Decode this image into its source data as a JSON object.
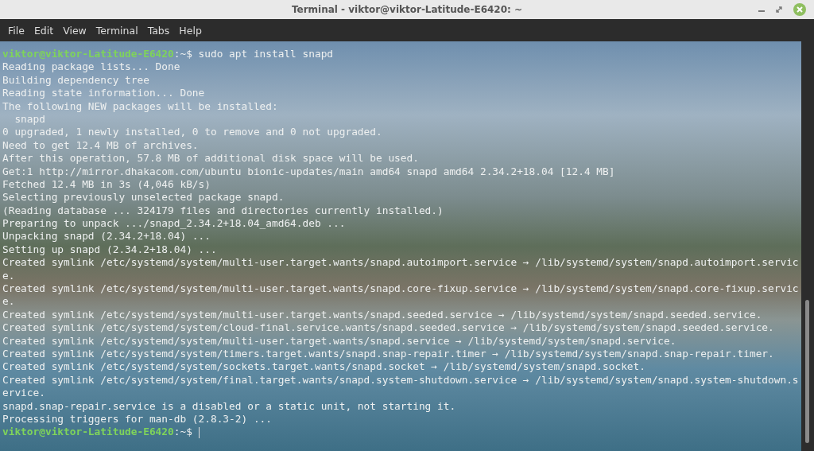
{
  "window": {
    "title": "Terminal - viktor@viktor-Latitude-E6420: ~"
  },
  "menu": [
    "File",
    "Edit",
    "View",
    "Terminal",
    "Tabs",
    "Help"
  ],
  "terminal": {
    "lines": [
      {
        "kind": "prompt",
        "host": "viktor@viktor-Latitude-E6420",
        "prompt": ":~$ ",
        "command": "sudo apt install snapd"
      },
      {
        "kind": "output",
        "text": "Reading package lists... Done"
      },
      {
        "kind": "output",
        "text": "Building dependency tree"
      },
      {
        "kind": "output",
        "text": "Reading state information... Done"
      },
      {
        "kind": "output",
        "text": "The following NEW packages will be installed:"
      },
      {
        "kind": "output",
        "text": "  snapd"
      },
      {
        "kind": "output",
        "text": "0 upgraded, 1 newly installed, 0 to remove and 0 not upgraded."
      },
      {
        "kind": "output",
        "text": "Need to get 12.4 MB of archives."
      },
      {
        "kind": "output",
        "text": "After this operation, 57.8 MB of additional disk space will be used."
      },
      {
        "kind": "output",
        "text": "Get:1 http://mirror.dhakacom.com/ubuntu bionic-updates/main amd64 snapd amd64 2.34.2+18.04 [12.4 MB]"
      },
      {
        "kind": "output",
        "text": "Fetched 12.4 MB in 3s (4,046 kB/s)"
      },
      {
        "kind": "output",
        "text": "Selecting previously unselected package snapd."
      },
      {
        "kind": "output",
        "text": "(Reading database ... 324179 files and directories currently installed.)"
      },
      {
        "kind": "output",
        "text": "Preparing to unpack .../snapd_2.34.2+18.04_amd64.deb ..."
      },
      {
        "kind": "output",
        "text": "Unpacking snapd (2.34.2+18.04) ..."
      },
      {
        "kind": "output",
        "text": "Setting up snapd (2.34.2+18.04) ..."
      },
      {
        "kind": "output",
        "text": "Created symlink /etc/systemd/system/multi-user.target.wants/snapd.autoimport.service → /lib/systemd/system/snapd.autoimport.servic"
      },
      {
        "kind": "output",
        "text": "e."
      },
      {
        "kind": "output",
        "text": "Created symlink /etc/systemd/system/multi-user.target.wants/snapd.core-fixup.service → /lib/systemd/system/snapd.core-fixup.servic"
      },
      {
        "kind": "output",
        "text": "e."
      },
      {
        "kind": "output",
        "text": "Created symlink /etc/systemd/system/multi-user.target.wants/snapd.seeded.service → /lib/systemd/system/snapd.seeded.service."
      },
      {
        "kind": "output",
        "text": "Created symlink /etc/systemd/system/cloud-final.service.wants/snapd.seeded.service → /lib/systemd/system/snapd.seeded.service."
      },
      {
        "kind": "output",
        "text": "Created symlink /etc/systemd/system/multi-user.target.wants/snapd.service → /lib/systemd/system/snapd.service."
      },
      {
        "kind": "output",
        "text": "Created symlink /etc/systemd/system/timers.target.wants/snapd.snap-repair.timer → /lib/systemd/system/snapd.snap-repair.timer."
      },
      {
        "kind": "output",
        "text": "Created symlink /etc/systemd/system/sockets.target.wants/snapd.socket → /lib/systemd/system/snapd.socket."
      },
      {
        "kind": "output",
        "text": "Created symlink /etc/systemd/system/final.target.wants/snapd.system-shutdown.service → /lib/systemd/system/snapd.system-shutdown.s"
      },
      {
        "kind": "output",
        "text": "ervice."
      },
      {
        "kind": "output",
        "text": "snapd.snap-repair.service is a disabled or a static unit, not starting it."
      },
      {
        "kind": "output",
        "text": "Processing triggers for man-db (2.8.3-2) ..."
      },
      {
        "kind": "prompt",
        "host": "viktor@viktor-Latitude-E6420",
        "prompt": ":~$ ",
        "cursor": true
      }
    ]
  }
}
